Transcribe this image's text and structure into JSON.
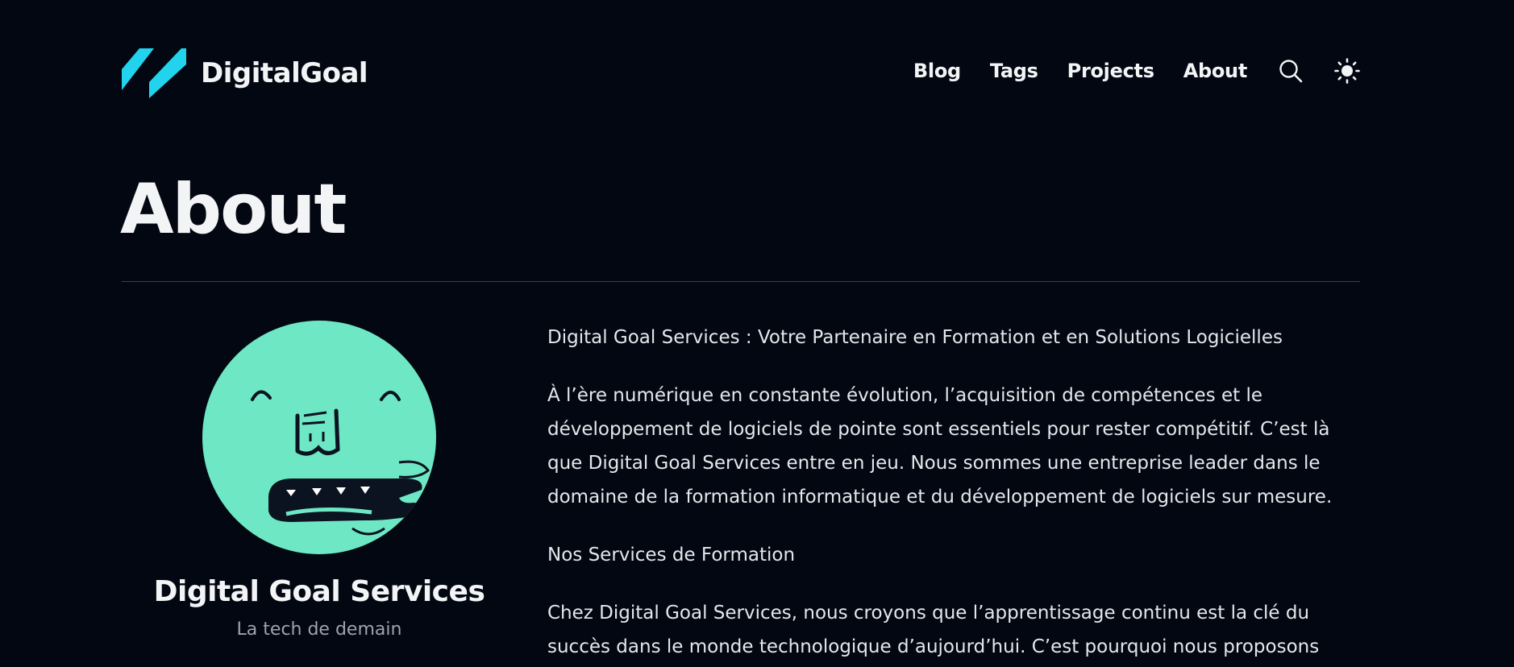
{
  "header": {
    "brand_name": "DigitalGoal",
    "nav": [
      {
        "label": "Blog"
      },
      {
        "label": "Tags"
      },
      {
        "label": "Projects"
      },
      {
        "label": "About"
      }
    ],
    "search_icon": "search-icon",
    "theme_icon": "sun-icon"
  },
  "page": {
    "title": "About"
  },
  "profile": {
    "name": "Digital Goal Services",
    "tagline": "La tech de demain",
    "avatar_color": "#6ee7c4"
  },
  "content": {
    "paragraphs": [
      "Digital Goal Services : Votre Partenaire en Formation et en Solutions Logicielles",
      "À l’ère numérique en constante évolution, l’acquisition de compétences et le développement de logiciels de pointe sont essentiels pour rester compétitif. C’est là que Digital Goal Services entre en jeu. Nous sommes une entreprise leader dans le domaine de la formation informatique et du développement de logiciels sur mesure.",
      "Nos Services de Formation",
      "Chez Digital Goal Services, nous croyons que l’apprentissage continu est la clé du succès dans le monde technologique d’aujourd’hui. C’est pourquoi nous proposons"
    ]
  },
  "colors": {
    "background": "#030712",
    "logo_cyan": "#22d3ee",
    "text": "#f3f4f6",
    "muted": "#9ca3af"
  }
}
